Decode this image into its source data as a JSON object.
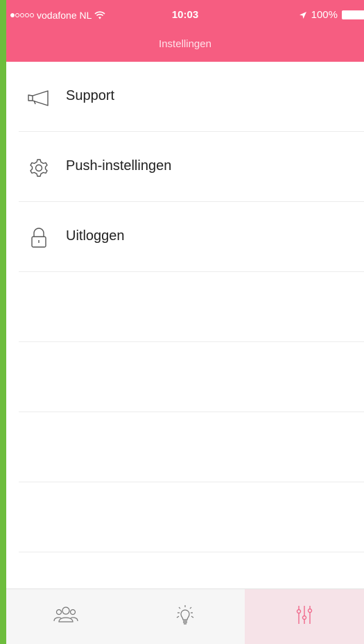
{
  "status_bar": {
    "carrier": "vodafone NL",
    "time": "10:03",
    "battery": "100%"
  },
  "header": {
    "title": "Instellingen"
  },
  "menu": {
    "items": [
      {
        "label": "Support",
        "icon": "megaphone-icon"
      },
      {
        "label": "Push-instellingen",
        "icon": "gear-icon"
      },
      {
        "label": "Uitloggen",
        "icon": "lock-icon"
      }
    ]
  },
  "tabbar": {
    "tabs": [
      {
        "icon": "group-icon",
        "active": false
      },
      {
        "icon": "lightbulb-icon",
        "active": false
      },
      {
        "icon": "sliders-icon",
        "active": true
      }
    ]
  },
  "colors": {
    "brand": "#f65d81",
    "frame": "#6dbd3d",
    "active_tab": "#f6e3e8"
  }
}
